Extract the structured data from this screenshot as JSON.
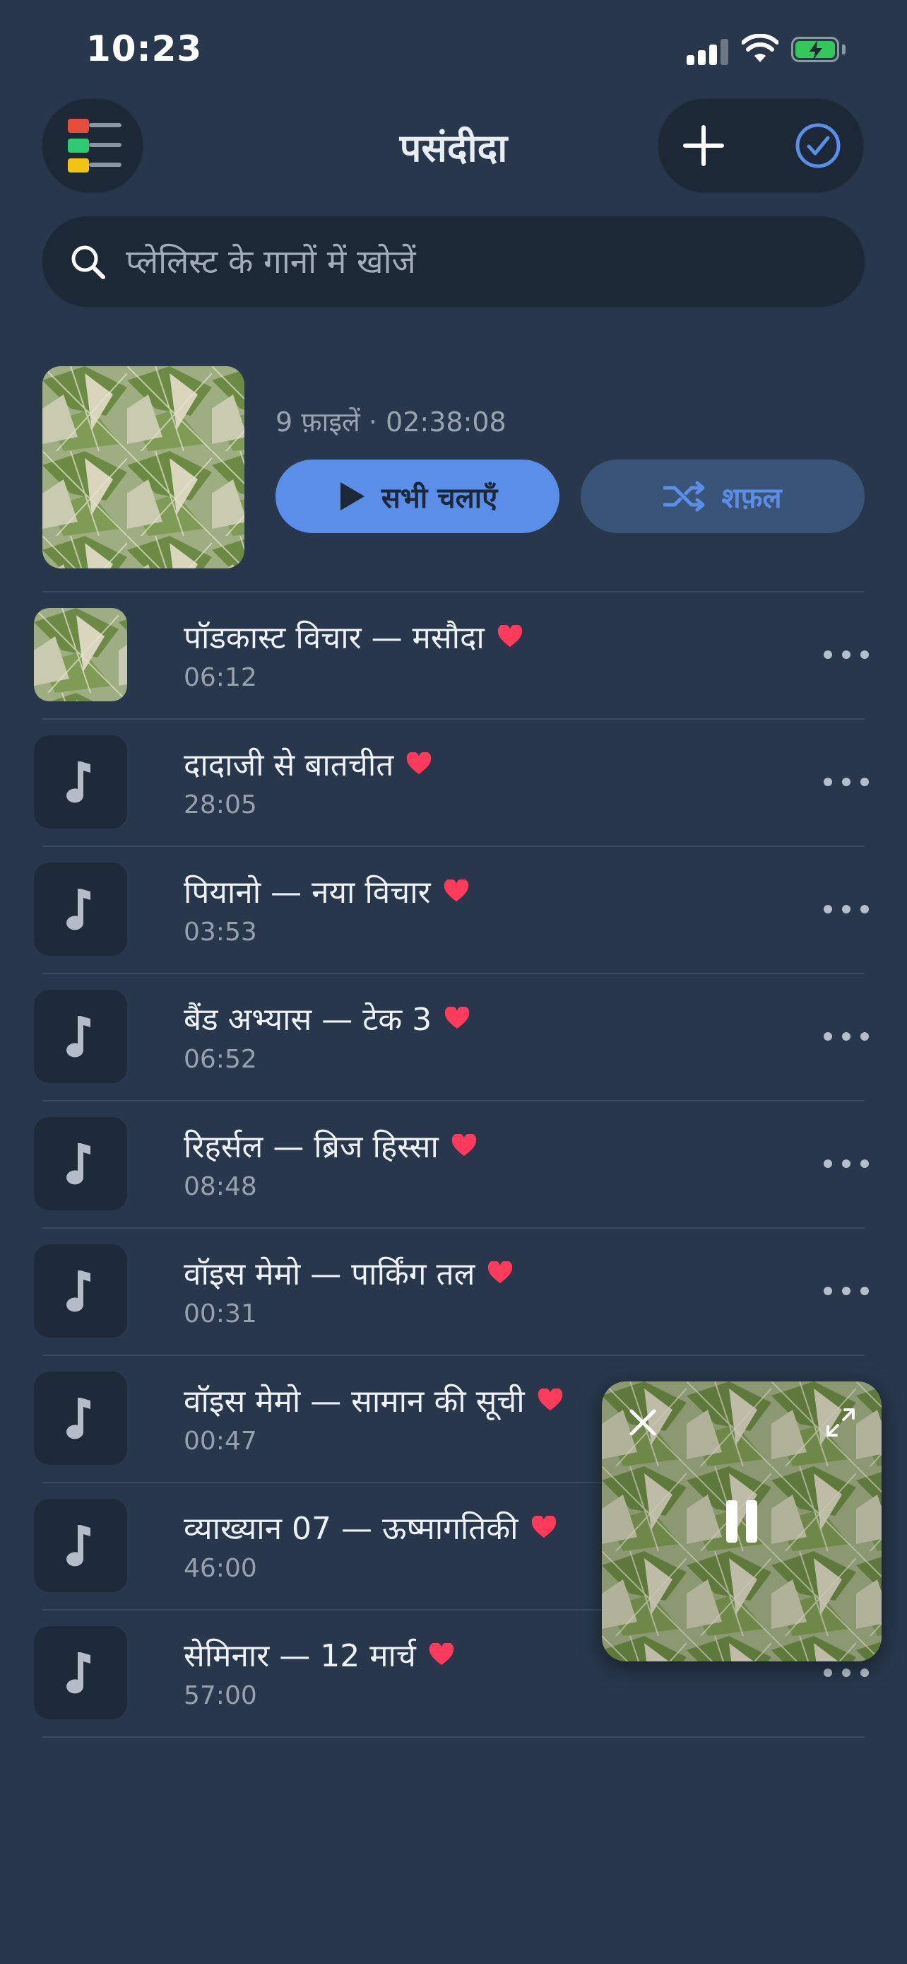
{
  "status_bar": {
    "time": "10:23"
  },
  "header": {
    "title": "पसंदीदा"
  },
  "search": {
    "placeholder": "प्लेलिस्ट के गानों में खोजें"
  },
  "summary": {
    "meta": "9 फ़ाइलें · 02:38:08",
    "play_all_label": "सभी चलाएँ",
    "shuffle_label": "शफ़ल"
  },
  "tracks": [
    {
      "title": "पॉडकास्ट विचार — मसौदा",
      "duration": "06:12",
      "has_artwork": true,
      "favorite": true
    },
    {
      "title": "दादाजी से बातचीत",
      "duration": "28:05",
      "has_artwork": false,
      "favorite": true
    },
    {
      "title": "पियानो — नया विचार",
      "duration": "03:53",
      "has_artwork": false,
      "favorite": true
    },
    {
      "title": "बैंड अभ्यास — टेक 3",
      "duration": "06:52",
      "has_artwork": false,
      "favorite": true
    },
    {
      "title": "रिहर्सल — ब्रिज हिस्सा",
      "duration": "08:48",
      "has_artwork": false,
      "favorite": true
    },
    {
      "title": "वॉइस मेमो — पार्किंग तल",
      "duration": "00:31",
      "has_artwork": false,
      "favorite": true
    },
    {
      "title": "वॉइस मेमो — सामान की सूची",
      "duration": "00:47",
      "has_artwork": false,
      "favorite": true
    },
    {
      "title": "व्याख्यान 07 — ऊष्मागतिकी",
      "duration": "46:00",
      "has_artwork": false,
      "favorite": true
    },
    {
      "title": "सेमिनार — 12 मार्च",
      "duration": "57:00",
      "has_artwork": false,
      "favorite": true
    }
  ],
  "colors": {
    "background": "#28374c",
    "accent": "#5b8ee8",
    "heart": "#ff3b5c",
    "battery": "#34c759"
  },
  "icons": {
    "menu": "color-lines-menu-icon",
    "add": "plus-icon",
    "select": "check-circle-icon",
    "search": "search-icon",
    "play": "play-icon",
    "shuffle": "shuffle-icon",
    "note": "music-note-icon",
    "more": "more-horizontal-icon",
    "close": "close-icon",
    "expand": "expand-icon",
    "pause": "pause-icon"
  }
}
